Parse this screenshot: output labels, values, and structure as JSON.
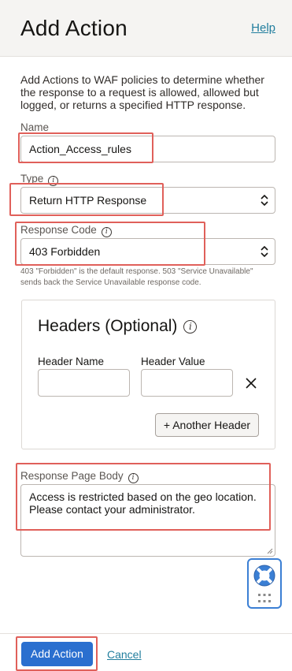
{
  "header": {
    "title": "Add Action",
    "help_link": "Help"
  },
  "intro_text": "Add Actions to WAF policies to determine whether the response to a request is allowed, allowed but logged, or returns a specified HTTP response.",
  "fields": {
    "name": {
      "label": "Name",
      "value": "Action_Access_rules"
    },
    "type": {
      "label": "Type",
      "value": "Return HTTP Response"
    },
    "response_code": {
      "label": "Response Code",
      "value": "403 Forbidden",
      "hint": "403 \"Forbidden\" is the default response. 503 \"Service Unavailable\" sends back the Service Unavailable response code."
    },
    "response_page_body": {
      "label": "Response Page Body",
      "value": "Access is restricted based on the geo location. Please contact your administrator."
    }
  },
  "headers_section": {
    "title": "Headers (Optional)",
    "header_name_label": "Header Name",
    "header_value_label": "Header Value",
    "header_name_value": "",
    "header_value_value": "",
    "another_header_button": "+ Another Header"
  },
  "footer": {
    "primary_button": "Add Action",
    "cancel_link": "Cancel"
  },
  "colors": {
    "accent": "#2a6fcf",
    "link": "#227e9e",
    "annotation": "#e0605a",
    "helpdesk": "#3b7fd4"
  },
  "icons": {
    "info": "info-icon",
    "close": "close-icon",
    "select": "select-arrows-icon",
    "help_desk": "lifebuoy-icon"
  }
}
